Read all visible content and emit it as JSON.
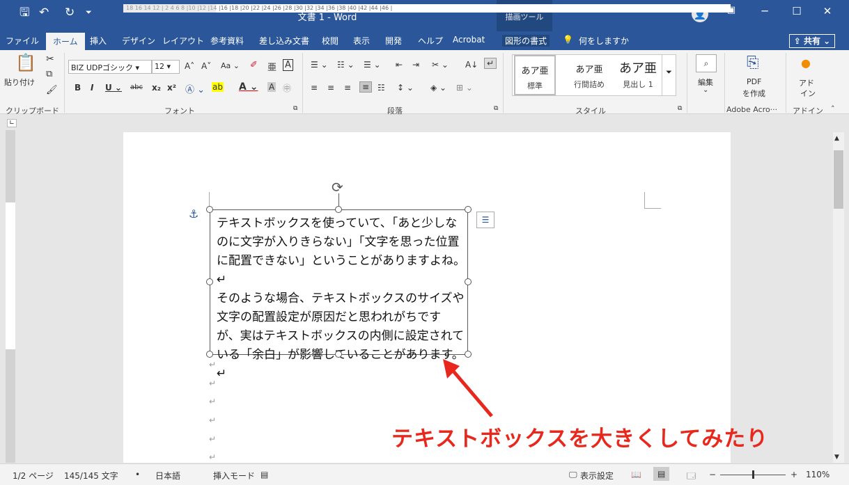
{
  "titlebar": {
    "title": "文書 1  -  Word",
    "context_tab_header": "描画ツール",
    "icons": {
      "save": "save-icon",
      "undo": "undo-icon",
      "redo": "redo-icon",
      "customize": "customize-qat-icon"
    }
  },
  "menu": {
    "tabs": [
      "ファイル",
      "ホーム",
      "挿入",
      "デザイン",
      "レイアウト",
      "参考資料",
      "差し込み文書",
      "校閲",
      "表示",
      "開発",
      "ヘルプ",
      "Acrobat",
      "図形の書式"
    ],
    "active_tab": "ホーム",
    "tellme": "何をしますか",
    "share": "共有"
  },
  "ribbon": {
    "clipboard": {
      "paste": "貼り付け",
      "label": "クリップボード"
    },
    "font": {
      "name": "BIZ UDPゴシック",
      "size": "12",
      "label": "フォント",
      "case_button": "Aa"
    },
    "paragraph": {
      "label": "段落"
    },
    "styles": {
      "label": "スタイル",
      "items": [
        {
          "preview": "あア亜",
          "name": "標準"
        },
        {
          "preview": "あア亜",
          "name": "行間詰め"
        },
        {
          "preview": "あア亜",
          "name": "見出し 1"
        }
      ]
    },
    "edit": {
      "label": "編集"
    },
    "acrobat": {
      "pdf_line1": "PDF",
      "pdf_line2": "を作成",
      "label": "Adobe Acro···"
    },
    "addins": {
      "line1": "アド",
      "line2": "イン",
      "label": "アドイン"
    }
  },
  "ruler": {
    "h_text": "18  16  14  12    | 2   4   6   8   |10  |12  |14  |16  |18  |20  |22  |24  |26  |28  |30  |32  |34  |36  |38  |40  |42  |44  |46  |"
  },
  "document": {
    "textbox_lines": [
      "テキストボックスを使っていて、「あと少しな",
      "のに文字が入りきらない」「文字を思った位置",
      "に配置できない」ということがありますよね。↵",
      "そのような場合、テキストボックスのサイズや",
      "文字の配置設定が原因だと思われがちです",
      "が、実はテキストボックスの内側に設定されて",
      "いる「余白」が影響していることがあります。↵"
    ],
    "paragraph_mark": "↵",
    "annotation": "テキストボックスを大きくしてみたり"
  },
  "status": {
    "page": "1/2 ページ",
    "words": "145/145 文字",
    "language": "日本語",
    "mode": "挿入モード",
    "display_settings": "表示設定",
    "zoom": "110%"
  },
  "colors": {
    "accent": "#2b579a",
    "annotation": "#e8281c"
  }
}
